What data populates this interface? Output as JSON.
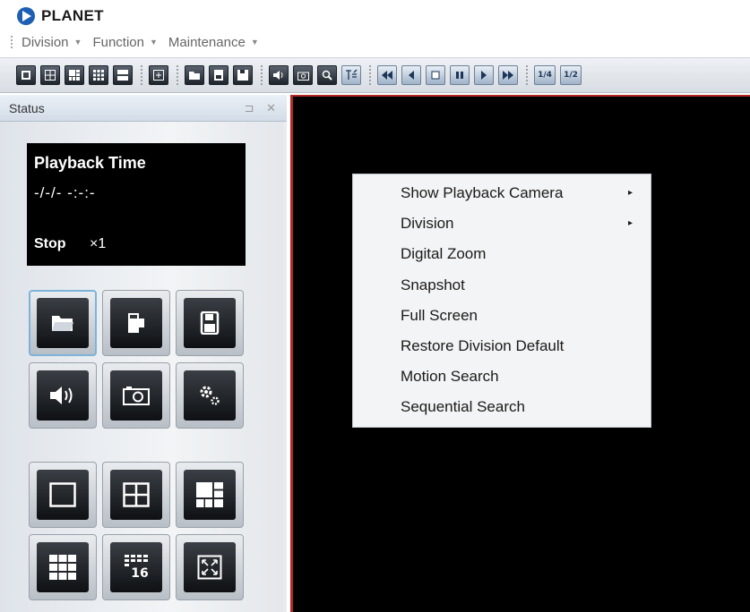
{
  "app": {
    "title": "PLANET"
  },
  "menu": [
    {
      "label": "Division"
    },
    {
      "label": "Function"
    },
    {
      "label": "Maintenance"
    }
  ],
  "toolbar": {
    "groups": [
      [
        "division-1-icon",
        "division-4-icon",
        "division-6-icon",
        "division-9-icon",
        "division-16-icon"
      ],
      [
        "fullscreen-icon"
      ],
      [
        "open-icon",
        "export-icon",
        "save-icon"
      ],
      [
        "audio-icon",
        "snapshot-icon",
        "zoom-icon",
        "motion-search-icon"
      ],
      [
        "fast-backward-icon",
        "step-backward-icon",
        "stop-icon",
        "pause-icon",
        "play-icon",
        "fast-forward-icon"
      ],
      [
        "speed-quarter",
        "speed-half"
      ]
    ],
    "speed_quarter_label": "1/4",
    "speed_half_label": "1/2"
  },
  "status": {
    "header": "Status",
    "pin_icon": "pin-icon",
    "close_icon": "close-icon",
    "playback_title": "Playback Time",
    "playback_time": "-/-/- -:-:-",
    "state": "Stop",
    "speed": "×1"
  },
  "controls": {
    "row1": [
      "open-folder-icon",
      "backup-icon",
      "save-disk-icon"
    ],
    "row2": [
      "volume-icon",
      "camera-snapshot-icon",
      "settings-gear-icon"
    ],
    "row3": [
      "single-view-icon",
      "quad-view-icon",
      "six-view-icon"
    ],
    "row4": [
      "nine-view-icon",
      "sixteen-view-icon",
      "fullscreen-expand-icon"
    ],
    "sixteen_label": "16"
  },
  "context_menu": {
    "items": [
      {
        "label": "Show Playback Camera",
        "submenu": true
      },
      {
        "label": "Division",
        "submenu": true
      },
      {
        "label": "Digital Zoom",
        "submenu": false
      },
      {
        "label": "Snapshot",
        "submenu": false
      },
      {
        "label": "Full Screen",
        "submenu": false
      },
      {
        "label": "Restore Division Default",
        "submenu": false
      },
      {
        "label": "Motion Search",
        "submenu": false
      },
      {
        "label": "Sequential Search",
        "submenu": false
      }
    ],
    "submenu_arrow": "▸"
  },
  "colors": {
    "video_border": "#b42828",
    "selected_button": "#7db3d8",
    "logo_blue": "#1e5fb4"
  }
}
